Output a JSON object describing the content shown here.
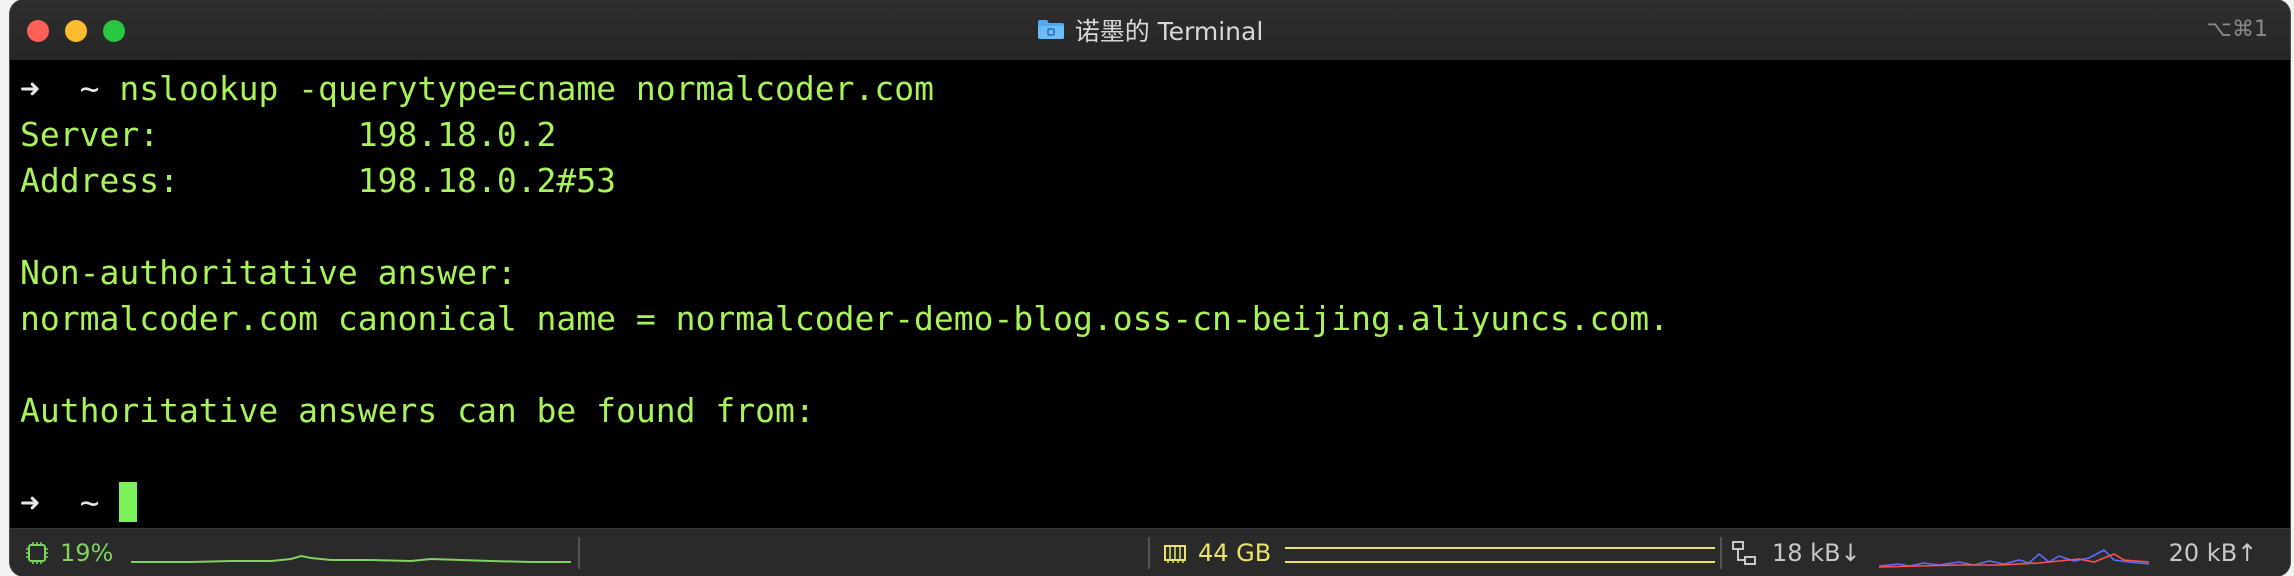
{
  "window": {
    "title": "诺墨的 Terminal",
    "shortcut": "⌥⌘1"
  },
  "terminal": {
    "lines": [
      {
        "prompt_arrow": "➜",
        "prompt_dir": "~",
        "command": "nslookup -querytype=cname normalcoder.com"
      },
      {
        "text": "Server:          198.18.0.2"
      },
      {
        "text": "Address:         198.18.0.2#53"
      },
      {
        "text": ""
      },
      {
        "text": "Non-authoritative answer:"
      },
      {
        "text": "normalcoder.com canonical name = normalcoder-demo-blog.oss-cn-beijing.aliyuncs.com."
      },
      {
        "text": ""
      },
      {
        "text": "Authoritative answers can be found from:"
      },
      {
        "text": ""
      },
      {
        "prompt_arrow": "➜",
        "prompt_dir": "~",
        "command": ""
      }
    ]
  },
  "statusbar": {
    "cpu": {
      "icon": "cpu-icon",
      "value": "19%",
      "color": "#7fd35f"
    },
    "memory": {
      "icon": "memory-icon",
      "value": "44 GB",
      "color": "#e8e56a"
    },
    "network": {
      "icon": "network-icon",
      "download": "18 kB↓",
      "upload": "20 kB↑"
    }
  },
  "colors": {
    "terminal_text": "#a8f25a",
    "background": "#000000",
    "cursor": "#7cf25a"
  }
}
